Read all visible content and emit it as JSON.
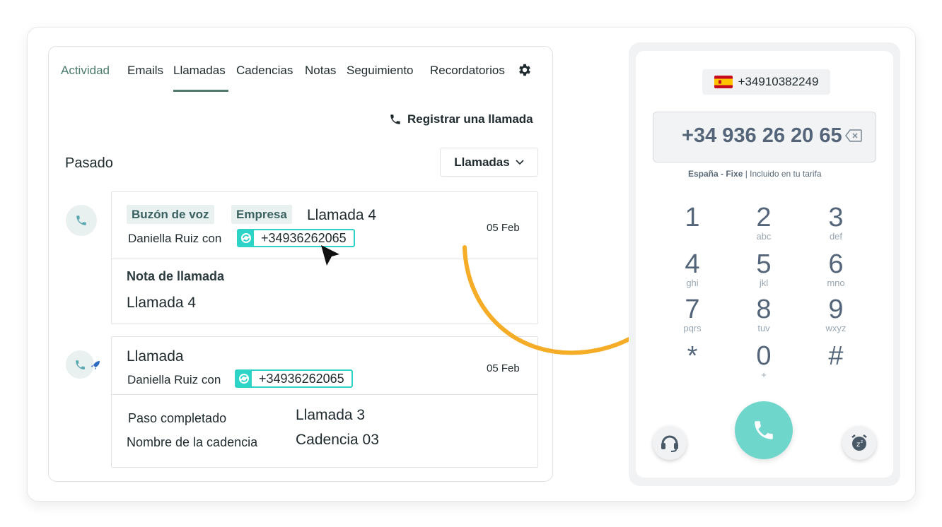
{
  "tabs": [
    {
      "label": "Actividad"
    },
    {
      "label": "Emails"
    },
    {
      "label": "Llamadas"
    },
    {
      "label": "Cadencias"
    },
    {
      "label": "Notas"
    },
    {
      "label": "Seguimiento"
    },
    {
      "label": "Recordatorios"
    }
  ],
  "register_call": "Registrar una llamada",
  "section_title": "Pasado",
  "filter": {
    "selected": "Llamadas"
  },
  "cards": [
    {
      "badges": [
        "Buzón de voz",
        "Empresa"
      ],
      "title": "Llamada 4",
      "who": "Daniella Ruiz con",
      "phone": "+34936262065",
      "date": "05 Feb",
      "note_label": "Nota de llamada",
      "note_value": "Llamada 4"
    },
    {
      "title": "Llamada",
      "who": "Daniella Ruiz con",
      "phone": "+34936262065",
      "date": "05 Feb",
      "rows": [
        {
          "label": "Paso completado",
          "value": "Llamada 3"
        },
        {
          "label": "Nombre de la cadencia",
          "value": "Cadencia 03"
        }
      ]
    }
  ],
  "dialer": {
    "from_number": "+34910382249",
    "dialed": "+34 936 26 20 65",
    "info_bold": "España - Fixe",
    "info_rest": "| Incluido en tu tarifa",
    "keys": [
      {
        "d": "1",
        "l": ""
      },
      {
        "d": "2",
        "l": "abc"
      },
      {
        "d": "3",
        "l": "def"
      },
      {
        "d": "4",
        "l": "ghi"
      },
      {
        "d": "5",
        "l": "jkl"
      },
      {
        "d": "6",
        "l": "mno"
      },
      {
        "d": "7",
        "l": "pqrs"
      },
      {
        "d": "8",
        "l": "tuv"
      },
      {
        "d": "9",
        "l": "wxyz"
      },
      {
        "d": "*",
        "l": ""
      },
      {
        "d": "0",
        "l": "+"
      },
      {
        "d": "#",
        "l": ""
      }
    ]
  },
  "colors": {
    "accent": "#4c7a6d",
    "teal": "#2ed3c8",
    "call": "#6fd6cc",
    "arrow": "#f5ac27"
  }
}
